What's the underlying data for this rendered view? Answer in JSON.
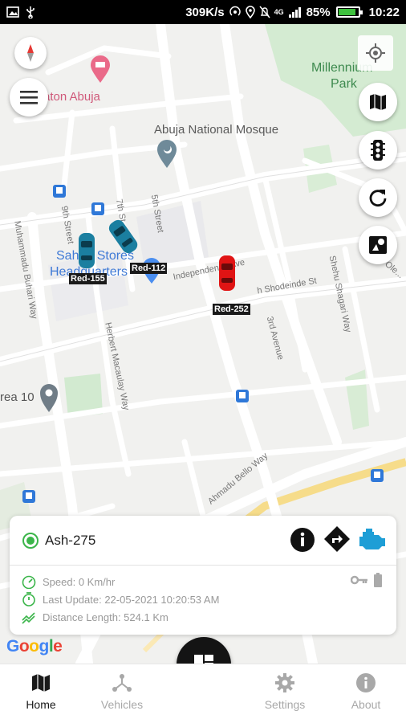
{
  "status_bar": {
    "network_speed": "309K/s",
    "battery_percent": "85%",
    "time": "10:22",
    "signal_label": "4G"
  },
  "map": {
    "places": [
      {
        "name": "aton Abuja"
      },
      {
        "name": "Abuja National Mosque"
      },
      {
        "name": "Millennium"
      },
      {
        "name": "Park"
      },
      {
        "name": "Sahad Stores"
      },
      {
        "name": "Headquarters"
      },
      {
        "name": "rea 10"
      }
    ],
    "roads": [
      {
        "name": "Independence Ave"
      },
      {
        "name": "3rd Avenue"
      },
      {
        "name": "5th Street"
      },
      {
        "name": "7th St"
      },
      {
        "name": "9th Street"
      },
      {
        "name": "Muhammadu Buhari Way"
      },
      {
        "name": "Herbert Macaulay Way"
      },
      {
        "name": "Ahmadu Bello Way"
      },
      {
        "name": "h Shodeinde St"
      },
      {
        "name": "Shehu Shagari Way"
      },
      {
        "name": "Ole..."
      }
    ],
    "vehicles": [
      {
        "tag": "Red-155",
        "color": "#1b7fa0"
      },
      {
        "tag": "Red-112",
        "color": "#1b7fa0"
      },
      {
        "tag": "Red-252",
        "color": "#e01414"
      }
    ],
    "attribution": "Google"
  },
  "controls": {
    "compass": "compass-icon",
    "menu": "menu-icon",
    "locate": "my-location-icon",
    "map_type": "map-icon",
    "traffic": "traffic-light-icon",
    "refresh": "refresh-icon",
    "layers": "shapes-icon"
  },
  "selected_vehicle": {
    "name": "Ash-275",
    "status_color": "#3bb54a",
    "speed": "Speed: 0 Km/hr",
    "last_update": "Last Update: 22-05-2021 10:20:53 AM",
    "distance": "Distance Length: 524.1 Km",
    "engine_color": "#1e9ed6"
  },
  "bottom_nav": {
    "items": [
      {
        "label": "Home",
        "icon": "map-icon",
        "active": true
      },
      {
        "label": "Vehicles",
        "icon": "hub-icon",
        "active": false
      },
      {
        "label": "Settings",
        "icon": "gear-icon",
        "active": false
      },
      {
        "label": "About",
        "icon": "info-icon",
        "active": false
      }
    ]
  }
}
